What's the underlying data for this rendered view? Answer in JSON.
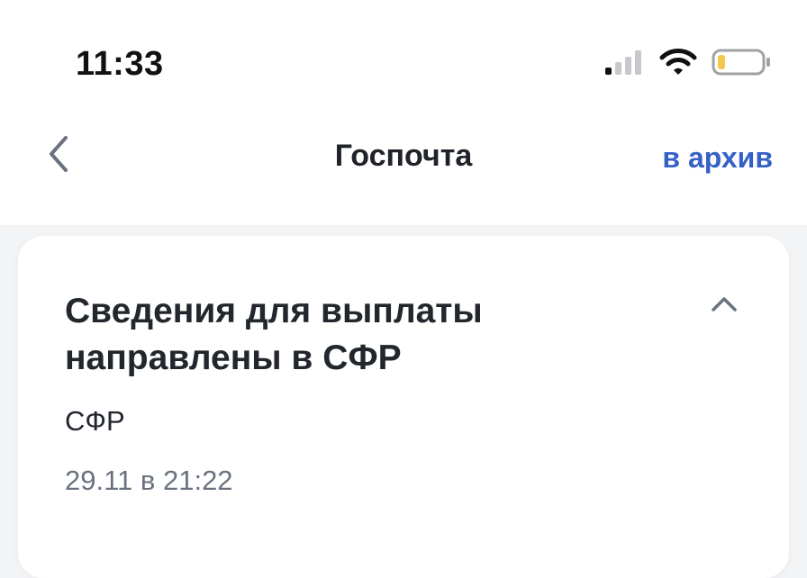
{
  "status_bar": {
    "time": "11:33",
    "icons": [
      "cellular-signal-icon",
      "wifi-icon",
      "battery-icon"
    ],
    "battery_color": "#f2c94c"
  },
  "nav": {
    "title": "Госпочта",
    "back_icon": "chevron-left-icon",
    "archive_label": "в архив"
  },
  "message": {
    "title": "Сведения для выплаты направлены в СФР",
    "sender": "СФР",
    "date": "29.11 в 21:22",
    "toggle_icon": "chevron-up-icon"
  },
  "colors": {
    "accent": "#3561c7",
    "background": "#f3f4f6",
    "card": "#ffffff",
    "muted_text": "#6a7280"
  }
}
